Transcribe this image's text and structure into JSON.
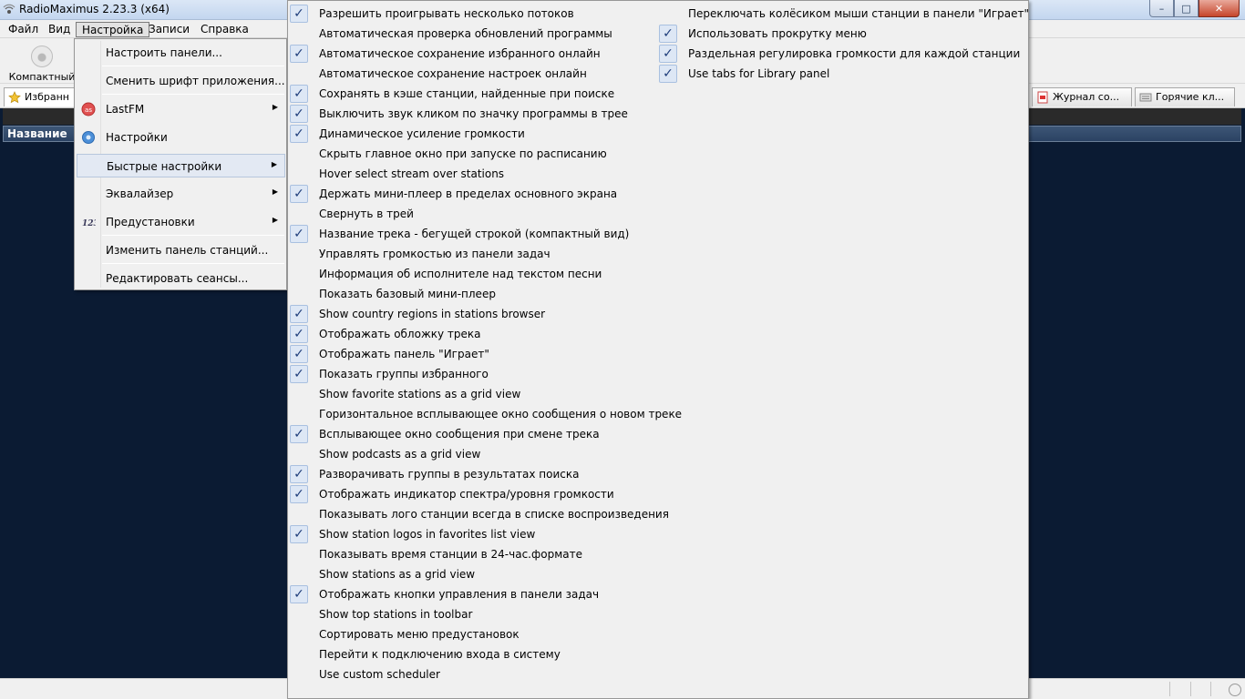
{
  "window": {
    "title": "RadioMaximus 2.23.3 (x64)",
    "controls": {
      "minimize": "–",
      "maximize": "□",
      "close": "✕"
    }
  },
  "menubar": {
    "items": [
      "Файл",
      "Вид",
      "Настройка",
      "Записи",
      "Справка"
    ],
    "active": "Настройка"
  },
  "toolbar": {
    "compact_label": "Компактный"
  },
  "tabs": {
    "favorites": "Избранн",
    "journal": "Журнал со...",
    "hotkeys": "Горячие кл..."
  },
  "table": {
    "column_name": "Название"
  },
  "settings_menu": {
    "items": [
      {
        "label": "Настроить панели...",
        "icon": "",
        "submenu": false
      },
      {
        "label": "Сменить шрифт приложения...",
        "icon": "",
        "submenu": false
      },
      {
        "label": "LastFM",
        "icon": "lastfm-icon",
        "submenu": true
      },
      {
        "label": "Настройки",
        "icon": "gear-icon",
        "submenu": false
      },
      {
        "label": "Быстрые настройки",
        "icon": "",
        "submenu": true,
        "active": true
      },
      {
        "label": "Эквалайзер",
        "icon": "",
        "submenu": true
      },
      {
        "label": "Предустановки",
        "icon": "presets-123-icon",
        "submenu": true
      },
      {
        "label": "Изменить панель станций...",
        "icon": "",
        "submenu": false
      },
      {
        "label": "Редактировать сеансы...",
        "icon": "",
        "submenu": false
      }
    ]
  },
  "quick_settings": {
    "column1": [
      {
        "label": "Разрешить проигрывать несколько потоков",
        "checked": true
      },
      {
        "label": "Автоматическая проверка обновлений программы",
        "checked": false
      },
      {
        "label": "Автоматическое сохранение избранного онлайн",
        "checked": true
      },
      {
        "label": "Автоматическое сохранение настроек онлайн",
        "checked": false
      },
      {
        "label": "Сохранять в кэше станции, найденные при поиске",
        "checked": true
      },
      {
        "label": "Выключить звук кликом по значку программы в трее",
        "checked": true
      },
      {
        "label": "Динамическое усиление громкости",
        "checked": true
      },
      {
        "label": "Скрыть главное окно при запуске по расписанию",
        "checked": false
      },
      {
        "label": "Hover select stream over stations",
        "checked": false
      },
      {
        "label": "Держать мини-плеер в пределах основного экрана",
        "checked": true
      },
      {
        "label": "Свернуть в трей",
        "checked": false
      },
      {
        "label": "Название трека - бегущей строкой (компактный вид)",
        "checked": true
      },
      {
        "label": "Управлять громкостью из панели задач",
        "checked": false
      },
      {
        "label": "Информация об исполнителе над текстом песни",
        "checked": false
      },
      {
        "label": "Показать базовый мини-плеер",
        "checked": false
      },
      {
        "label": "Show country regions in stations browser",
        "checked": true
      },
      {
        "label": "Отображать обложку трека",
        "checked": true
      },
      {
        "label": "Отображать панель \"Играет\"",
        "checked": true
      },
      {
        "label": "Показать группы избранного",
        "checked": true
      },
      {
        "label": "Show favorite stations as a grid view",
        "checked": false
      },
      {
        "label": "Горизонтальное всплывающее окно сообщения о новом треке",
        "checked": false
      },
      {
        "label": "Всплывающее окно сообщения при смене трека",
        "checked": true
      },
      {
        "label": "Show podcasts as a grid view",
        "checked": false
      },
      {
        "label": "Разворачивать группы в результатах поиска",
        "checked": true
      },
      {
        "label": "Отображать индикатор спектра/уровня громкости",
        "checked": true
      },
      {
        "label": "Показывать лого станции всегда в списке воспроизведения",
        "checked": false
      },
      {
        "label": "Show station logos in favorites list view",
        "checked": true
      },
      {
        "label": "Показывать время станции в 24-час.формате",
        "checked": false
      },
      {
        "label": "Show stations as a grid view",
        "checked": false
      },
      {
        "label": "Отображать кнопки управления в панели задач",
        "checked": true
      },
      {
        "label": "Show top stations in toolbar",
        "checked": false
      },
      {
        "label": "Сортировать меню предустановок",
        "checked": false
      },
      {
        "label": "Перейти к подключению входа в систему",
        "checked": false
      },
      {
        "label": "Use custom scheduler",
        "checked": false
      }
    ],
    "column2": [
      {
        "label": "Переключать колёсиком мыши станции в панели \"Играет\"",
        "checked": false
      },
      {
        "label": "Использовать прокрутку меню",
        "checked": true
      },
      {
        "label": "Раздельная регулировка громкости для каждой станции",
        "checked": true
      },
      {
        "label": "Use tabs for Library panel",
        "checked": true
      }
    ]
  }
}
